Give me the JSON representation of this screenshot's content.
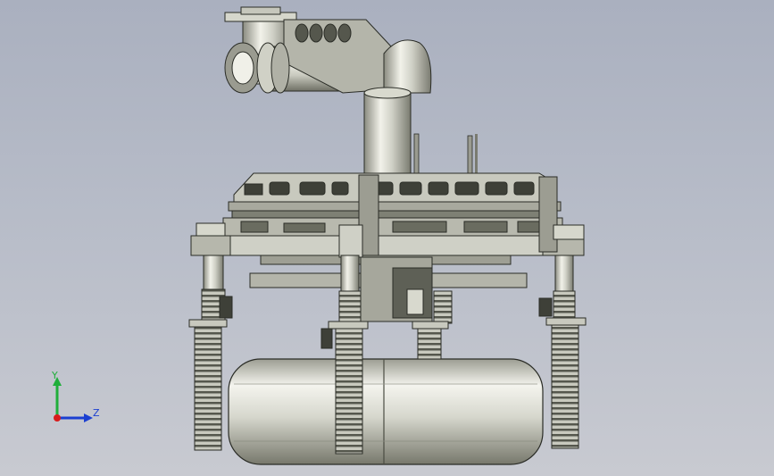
{
  "triad": {
    "y_label": "Y",
    "z_label": "Z",
    "y_color": "#1fae3a",
    "z_color": "#1b3fd1",
    "origin_color": "#d81c1c"
  },
  "model": {
    "metal_light": "#e8e8e0",
    "metal_mid": "#b8b9ad",
    "metal_dark": "#6e7064",
    "edge_color": "#2a2c26"
  }
}
